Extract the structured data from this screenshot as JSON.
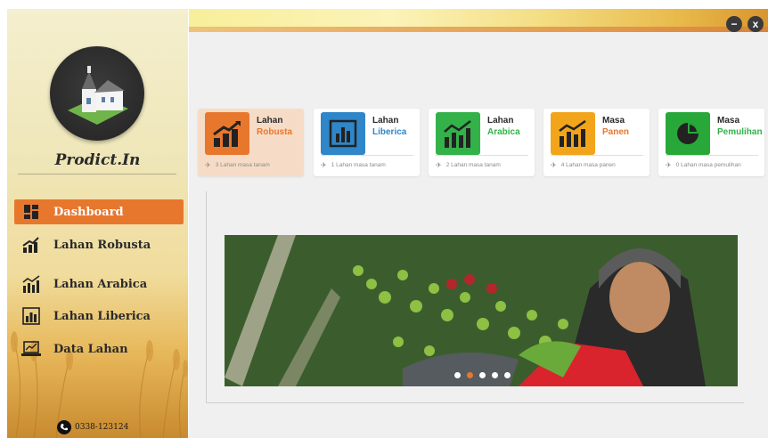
{
  "brand": {
    "name": "Prodict.In"
  },
  "window": {
    "minimize": "−",
    "close": "x"
  },
  "sidebar": {
    "items": [
      {
        "label": "Dashboard",
        "icon": "dashboard-icon",
        "active": true
      },
      {
        "label": "Lahan Robusta",
        "icon": "growth-chart-icon"
      },
      {
        "label": "Lahan Arabica",
        "icon": "bar-growth-icon"
      },
      {
        "label": "Lahan Liberica",
        "icon": "bar-chart-icon"
      },
      {
        "label": "Data Lahan",
        "icon": "laptop-chart-icon"
      }
    ],
    "phone": "0338-123124"
  },
  "cards": [
    {
      "title": "Lahan",
      "subtitle": "Robusta",
      "footer": "3 Lahan masa tanam",
      "color": "#e8772e",
      "subcolor": "#e8772e",
      "icon": "growth-chart-icon"
    },
    {
      "title": "Lahan",
      "subtitle": "Liberica",
      "footer": "1 Lahan masa tanam",
      "color": "#2f86c9",
      "subcolor": "#2f86c9",
      "icon": "bar-chart-icon"
    },
    {
      "title": "Lahan",
      "subtitle": "Arabica",
      "footer": "2 Lahan masa tanam",
      "color": "#33b24a",
      "subcolor": "#33b24a",
      "icon": "bar-growth-icon"
    },
    {
      "title": "Masa",
      "subtitle": "Panen",
      "footer": "4 Lahan masa panen",
      "color": "#f2a51a",
      "subcolor": "#e8772e",
      "icon": "hand-chart-icon"
    },
    {
      "title": "Masa",
      "subtitle": "Pemulihan",
      "footer": "0 Lahan masa pemulihan",
      "color": "#29a83a",
      "subcolor": "#33b24a",
      "icon": "pie-chart-icon"
    }
  ],
  "slider": {
    "active_index": 1,
    "count": 5
  },
  "colors": {
    "accent": "#e8772e"
  }
}
